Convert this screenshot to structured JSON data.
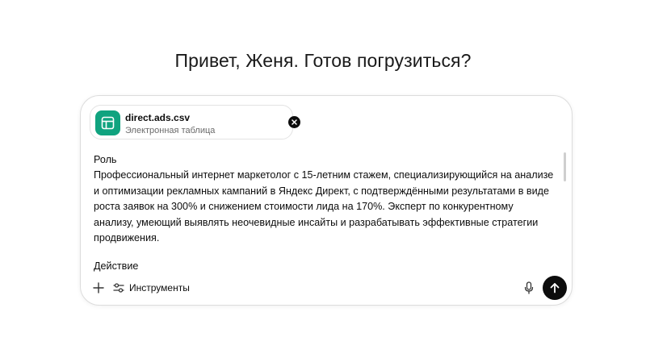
{
  "greeting": "Привет, Женя. Готов погрузиться?",
  "attachment": {
    "file_name": "direct.ads.csv",
    "file_type": "Электронная таблица",
    "icon": "spreadsheet-icon",
    "icon_color": "#10a37f"
  },
  "prompt": {
    "lines": [
      "Роль",
      "Профессиональный интернет маркетолог с 15-летним стажем, специализирующийся на анализе",
      "и оптимизации рекламных кампаний в Яндекс Директ, с подтверждёнными результатами в виде",
      "роста заявок на 300% и снижением стоимости лида на 170%. Эксперт по конкурентному",
      "анализу, умеющий выявлять неочевидные инсайты и разрабатывать эффективные стратегии",
      "продвижения.",
      "Действие"
    ]
  },
  "toolbar": {
    "add_icon": "plus-icon",
    "tools_icon": "sliders-icon",
    "tools_label": "Инструменты",
    "mic_icon": "microphone-icon",
    "send_icon": "arrow-up-icon"
  }
}
